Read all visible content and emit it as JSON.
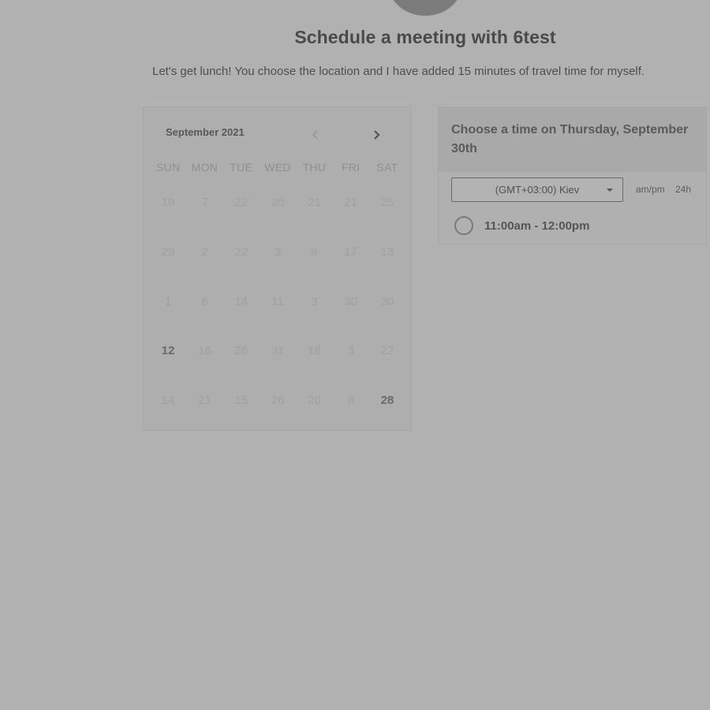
{
  "header": {
    "title": "Schedule a meeting with 6test",
    "description": "Let's get lunch! You choose the location and I have added 15 minutes of travel time for myself."
  },
  "calendar": {
    "month_label": "September 2021",
    "weekdays": [
      "SUN",
      "MON",
      "TUE",
      "WED",
      "THU",
      "FRI",
      "SAT"
    ],
    "weeks": [
      [
        "10",
        "7",
        "22",
        "26",
        "21",
        "21",
        "25"
      ],
      [
        "29",
        "2",
        "22",
        "3",
        "9",
        "17",
        "13"
      ],
      [
        "1",
        "6",
        "14",
        "11",
        "3",
        "30",
        "30"
      ],
      [
        "12",
        "16",
        "26",
        "31",
        "18",
        "3",
        "22"
      ],
      [
        "14",
        "21",
        "15",
        "26",
        "20",
        "8",
        "28"
      ]
    ],
    "active_days": [
      "3-0",
      "4-6"
    ]
  },
  "time_panel": {
    "heading": "Choose a time on Thursday, September 30th",
    "timezone": "(GMT+03:00) Kiev",
    "format_ampm": "am/pm",
    "format_24h": "24h",
    "slots": [
      "11:00am - 12:00pm"
    ]
  },
  "icons": {
    "prev": "chevron-left-icon",
    "next": "chevron-right-icon",
    "caret": "caret-down-icon"
  }
}
